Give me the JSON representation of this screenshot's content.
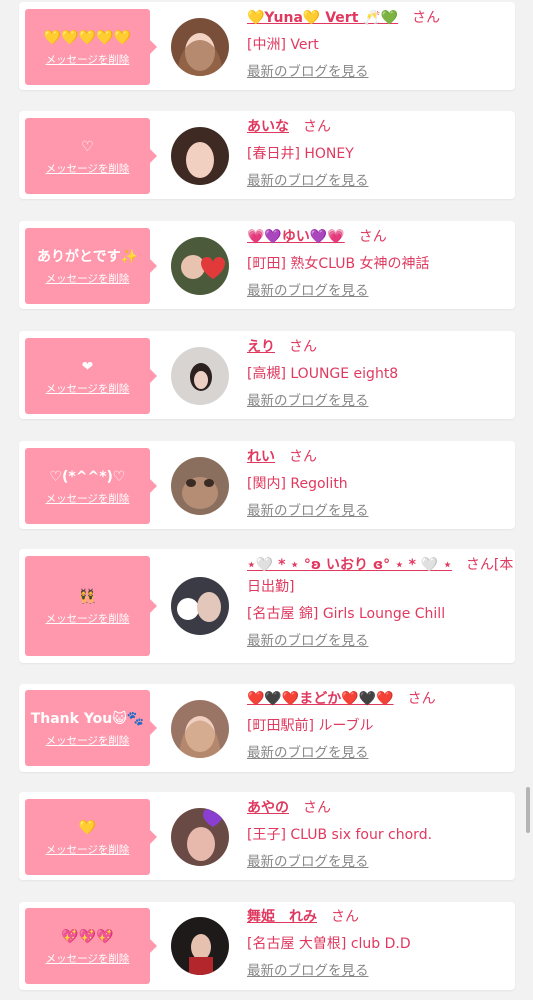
{
  "delete_label": "メッセージを削除",
  "blog_label": "最新のブログを見る",
  "san_label": "さん",
  "entries": [
    {
      "message": "💛💛💛💛💛",
      "name": "💛Yuna💛 Vert 🥂💚",
      "san": "さん",
      "shop": "[中洲] Vert"
    },
    {
      "message": "♡",
      "name": "あいな",
      "san": "さん",
      "shop": "[春日井] HONEY"
    },
    {
      "message": "ありがとです✨",
      "name": "💗💜ゆい💜💗",
      "san": "さん",
      "shop": "[町田] 熟女CLUB 女神の神話"
    },
    {
      "message": "❤",
      "name": "えり",
      "san": "さん",
      "shop": "[高槻] LOUNGE eight8"
    },
    {
      "message": "♡(*^^*)♡",
      "name": "れい",
      "san": "さん",
      "shop": "[関内] Regolith"
    },
    {
      "message": "👯",
      "name": "⋆🤍 * ⋆ °ʚ いおり ɞ° ⋆ * 🤍 ⋆",
      "san": "さん[本",
      "name_line2": "日出勤]",
      "shop": "[名古屋 錦] Girls Lounge Chill"
    },
    {
      "message": "Thank You😺🐾",
      "name": "❤️🖤❤️まどか❤️🖤❤️",
      "san": "さん",
      "shop": "[町田駅前] ルーブル"
    },
    {
      "message": "💛",
      "name": "あやの",
      "san": "さん",
      "shop": "[王子] CLUB six four chord."
    },
    {
      "message": "💖💖💖",
      "name": "舞姫　れみ",
      "san": "さん",
      "shop": "[名古屋 大曽根] club D.D"
    }
  ],
  "colors": {
    "bubble": "#ff98ad",
    "accent": "#e0395f",
    "link_gray": "#888888",
    "background": "#f2f2f2"
  }
}
